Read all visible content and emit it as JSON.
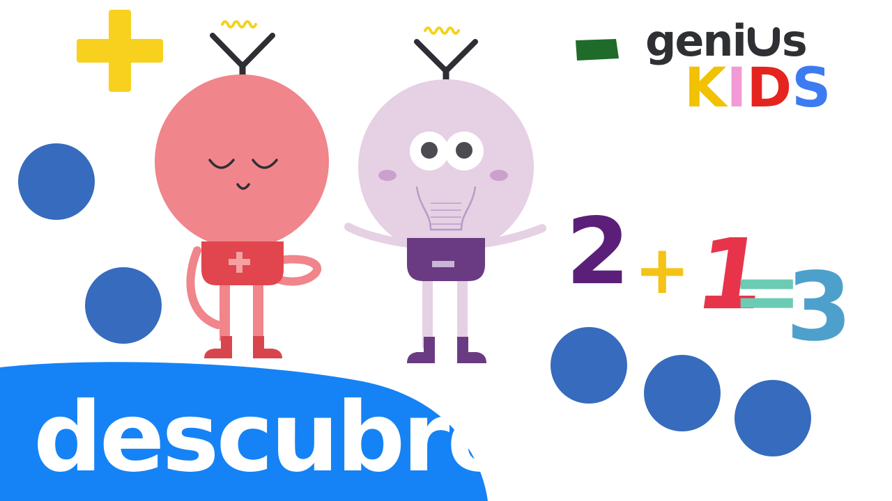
{
  "banner": {
    "text": "descubre"
  },
  "logo": {
    "brand_prefix": "geni",
    "brand_suffix": "s",
    "sub_letters": [
      "K",
      "I",
      "D",
      "S"
    ],
    "brand_color": "#2f3033",
    "sub_colors": [
      "#f2c200",
      "#f19ad5",
      "#e52420",
      "#3d7bf0"
    ]
  },
  "equation": {
    "chars": [
      "2",
      "+",
      "1",
      "=",
      "3"
    ],
    "colors": [
      "#5b1f79",
      "#f4c316",
      "#e8344a",
      "#6ccbb3",
      "#4ea0cc"
    ]
  },
  "colors": {
    "banner": "#1583f5",
    "dots": "#366bbd",
    "plus_symbol": "#f7d11e",
    "minus_symbol": "#1f6b2a",
    "plus_character_body": "#f0858b",
    "minus_character_body": "#e5d1e3"
  },
  "icons": [
    "plus-symbol-icon",
    "minus-symbol-icon",
    "plus-character",
    "minus-character"
  ]
}
